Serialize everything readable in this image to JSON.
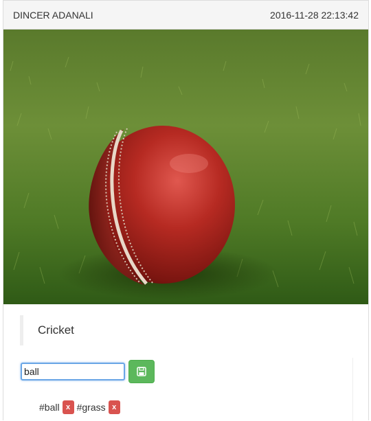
{
  "post": {
    "author": "DINCER ADANALI",
    "timestamp": "2016-11-28 22:13:42",
    "title": "Cricket"
  },
  "image": {
    "subject": "red cricket ball on grass"
  },
  "tag_editor": {
    "input_value": "ball",
    "save_icon": "floppy-disk-icon",
    "remove_label": "x"
  },
  "tags": [
    {
      "label": "#ball"
    },
    {
      "label": "#grass"
    }
  ],
  "colors": {
    "save_button": "#5cb85c",
    "remove_button": "#d9534f",
    "input_focus": "#6aa6e6"
  }
}
